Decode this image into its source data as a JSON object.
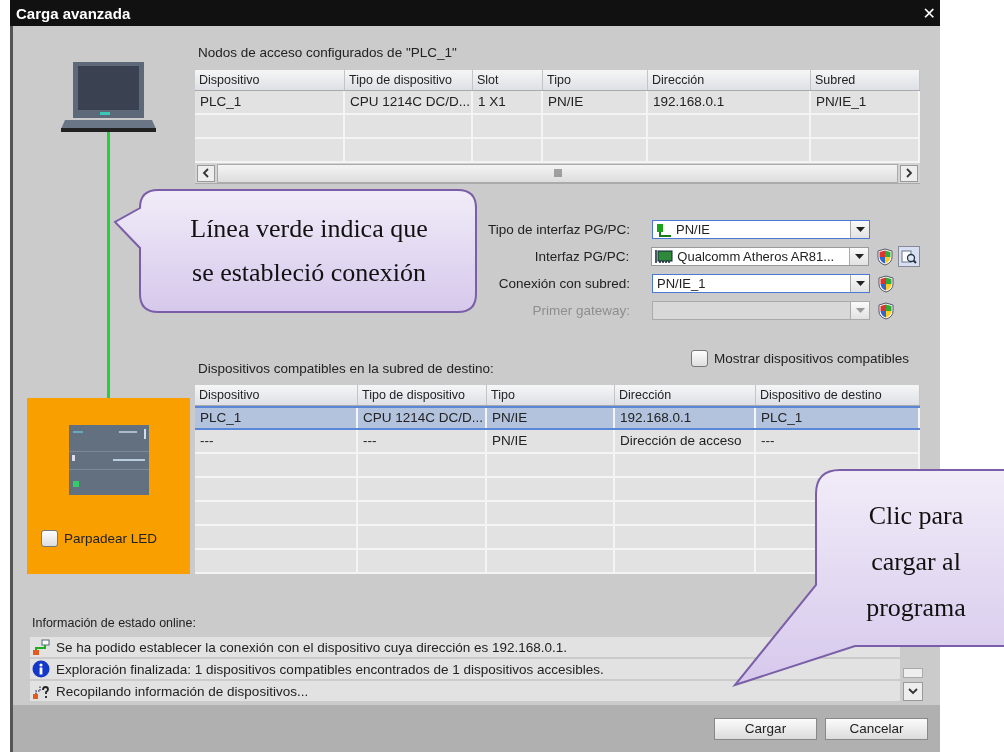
{
  "window": {
    "title": "Carga avanzada",
    "close": "✕"
  },
  "access_nodes": {
    "title": "Nodos de acceso configurados de \"PLC_1\"",
    "columns": [
      "Dispositivo",
      "Tipo de dispositivo",
      "Slot",
      "Tipo",
      "Dirección",
      "Subred"
    ],
    "rows": [
      [
        "PLC_1",
        "CPU 1214C DC/D...",
        "1 X1",
        "PN/IE",
        "192.168.0.1",
        "PN/IE_1"
      ]
    ]
  },
  "interface": [
    {
      "label": "Tipo de interfaz PG/PC:",
      "value": "PN/IE",
      "kind": "pnie",
      "highlighted": true,
      "disabled": false,
      "shield": false,
      "search_button": false
    },
    {
      "label": "Interfaz PG/PC:",
      "value": "Qualcomm Atheros AR81...",
      "kind": "nic",
      "highlighted": false,
      "disabled": false,
      "shield": true,
      "search_button": true
    },
    {
      "label": "Conexión con subred:",
      "value": "PN/IE_1",
      "kind": "plain",
      "highlighted": true,
      "disabled": false,
      "shield": true,
      "search_button": false
    },
    {
      "label": "Primer gateway:",
      "kind": "plain",
      "highlighted": false,
      "disabled": true,
      "shield": true,
      "search_button": false
    }
  ],
  "compatible": {
    "title": "Dispositivos compatibles en la subred de destino:",
    "show_all": {
      "label": "Mostrar dispositivos compatibles",
      "checked": false
    },
    "columns": [
      "Dispositivo",
      "Tipo de dispositivo",
      "Tipo",
      "Dirección",
      "Dispositivo de destino"
    ],
    "rows": [
      {
        "cells": [
          "PLC_1",
          "CPU 1214C DC/D...",
          "PN/IE",
          "192.168.0.1",
          "PLC_1"
        ],
        "selected": true
      },
      {
        "cells": [
          "---",
          "---",
          "PN/IE",
          "Dirección de acceso",
          "---"
        ],
        "selected": false
      }
    ]
  },
  "device": {
    "flash_led": {
      "label": "Parpadear LED",
      "checked": false
    }
  },
  "status": {
    "title": "Información de estado online:",
    "messages": [
      {
        "kind": "connected",
        "text": "Se ha podido establecer la conexión con el dispositivo cuya dirección es 192.168.0.1."
      },
      {
        "kind": "info",
        "text": "Exploración finalizada: 1 dispositivos compatibles encontrados de 1 dispositivos accesibles."
      },
      {
        "kind": "searching",
        "text": "Recopilando información de dispositivos..."
      }
    ]
  },
  "buttons": [
    {
      "label": "Cargar"
    },
    {
      "label": "Cancelar"
    }
  ],
  "callouts": [
    {
      "lines": [
        "Línea verde indica que",
        "se estableció conexión"
      ]
    },
    {
      "lines": [
        "Clic para",
        "cargar al",
        "programa"
      ]
    }
  ]
}
